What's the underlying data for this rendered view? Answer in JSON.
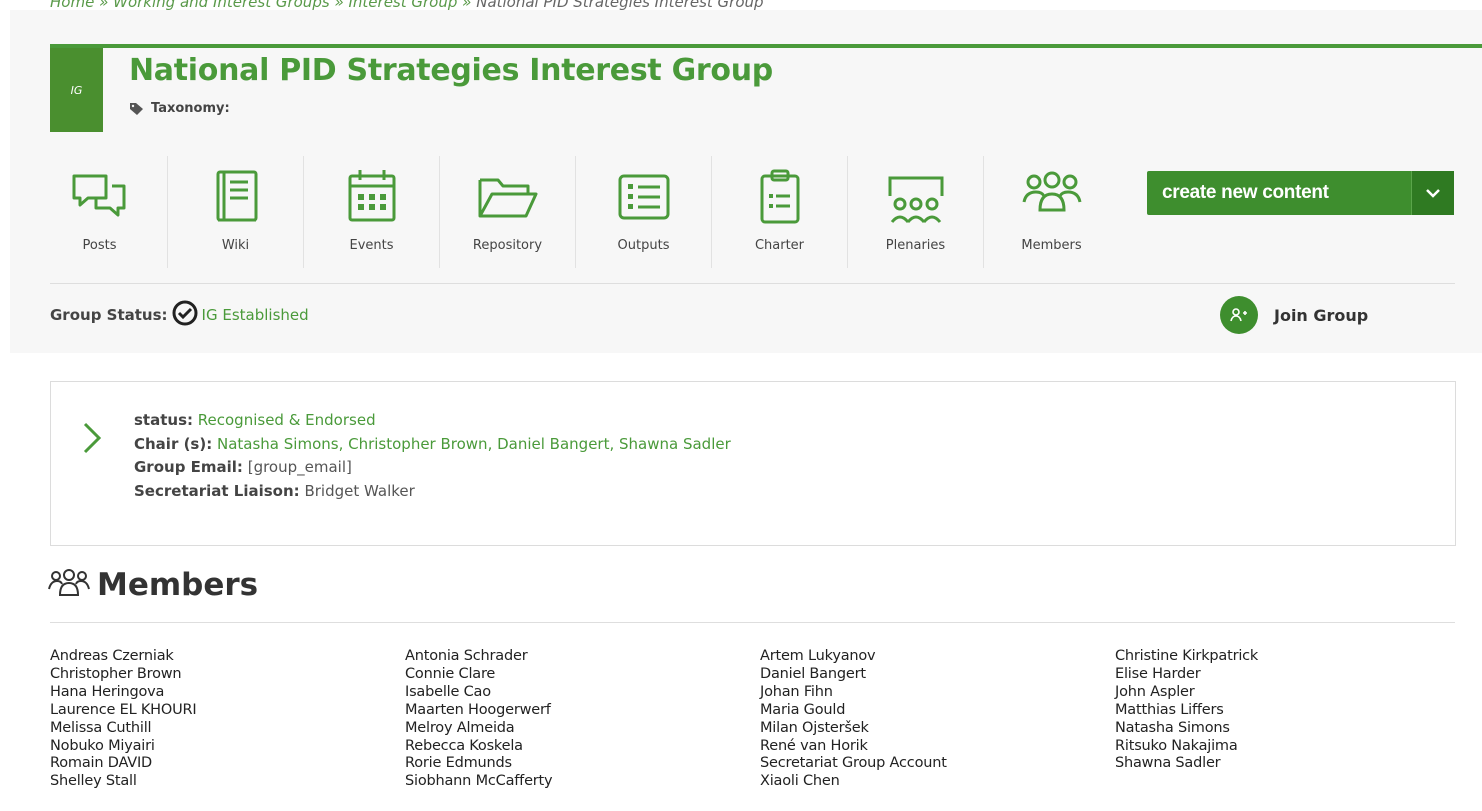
{
  "breadcrumb": {
    "items": [
      "Home",
      "Working and Interest Groups",
      "Interest Group"
    ],
    "separator": "»",
    "current": "National PID Strategies Interest Group"
  },
  "group": {
    "badge": "IG",
    "title": "National PID Strategies Interest Group",
    "taxonomy_label": "Taxonomy:"
  },
  "tabs": [
    {
      "label": "Posts",
      "icon": "posts-icon"
    },
    {
      "label": "Wiki",
      "icon": "wiki-icon"
    },
    {
      "label": "Events",
      "icon": "calendar-icon"
    },
    {
      "label": "Repository",
      "icon": "folder-icon"
    },
    {
      "label": "Outputs",
      "icon": "list-icon"
    },
    {
      "label": "Charter",
      "icon": "clipboard-icon"
    },
    {
      "label": "Plenaries",
      "icon": "plenaries-icon"
    },
    {
      "label": "Members",
      "icon": "members-icon"
    }
  ],
  "create_button": {
    "label": "create new content"
  },
  "group_status": {
    "label": "Group Status:",
    "value": "IG Established"
  },
  "join": {
    "label": "Join Group"
  },
  "info": {
    "status_label": "status:",
    "status_value": "Recognised & Endorsed",
    "chair_label": "Chair (s):",
    "chair_value": "Natasha Simons, Christopher Brown, Daniel Bangert, Shawna Sadler",
    "email_label": "Group Email:",
    "email_value": "[group_email]",
    "liaison_label": "Secretariat Liaison:",
    "liaison_value": "Bridget Walker"
  },
  "members": {
    "heading": "Members",
    "columns": [
      [
        "Andreas Czerniak",
        "Christopher Brown",
        "Hana Heringova",
        "Laurence EL KHOURI",
        "Melissa Cuthill",
        "Nobuko Miyairi",
        "Romain DAVID",
        "Shelley Stall"
      ],
      [
        "Antonia Schrader",
        "Connie Clare",
        "Isabelle Cao",
        "Maarten Hoogerwerf",
        "Melroy Almeida",
        "Rebecca Koskela",
        "Rorie Edmunds",
        "Siobhann McCafferty"
      ],
      [
        "Artem Lukyanov",
        "Daniel Bangert",
        "Johan Fihn",
        "Maria Gould",
        "Milan Ojsteršek",
        "René van Horik",
        "Secretariat Group Account",
        "Xiaoli Chen"
      ],
      [
        "Christine Kirkpatrick",
        "Elise Harder",
        "John Aspler",
        "Matthias Liffers",
        "Natasha Simons",
        "Ritsuko Nakajima",
        "Shawna Sadler"
      ]
    ]
  },
  "colors": {
    "brand_green": "#4a9a3a",
    "button_green": "#3e8e2e"
  }
}
